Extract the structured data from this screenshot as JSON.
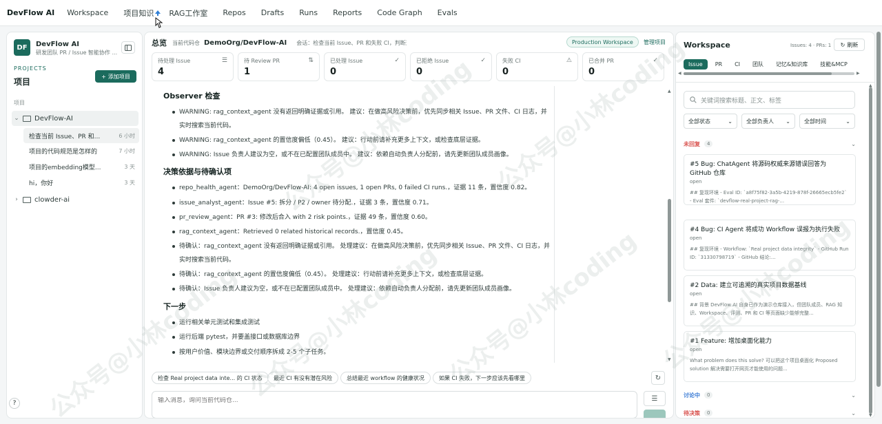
{
  "topnav": {
    "brand": "DevFlow AI",
    "items": [
      "Workspace",
      "项目知识",
      "RAG工作室",
      "Repos",
      "Drafts",
      "Runs",
      "Reports",
      "Code Graph",
      "Evals"
    ]
  },
  "sidebar": {
    "logo": "DF",
    "app_name": "DevFlow AI",
    "app_sub": "研发团队 PR / Issue 智能协作 ...",
    "projects_caption": "PROJECTS",
    "projects_title": "项目",
    "add_project": "添加项目",
    "section_label": "项目",
    "tree": [
      {
        "name": "DevFlow-AI",
        "expanded": true
      },
      {
        "name": "clowder-ai",
        "expanded": false
      }
    ],
    "conversations": [
      {
        "title": "检查当前 Issue、PR 和...",
        "time": "6 小时"
      },
      {
        "title": "项目的代码规范是怎样的",
        "time": "7 小时"
      },
      {
        "title": "项目的embedding模型...",
        "time": "3 天"
      },
      {
        "title": "hi，你好",
        "time": "3 天"
      }
    ],
    "help_icon": "?"
  },
  "center": {
    "title": "总览",
    "current_repo_label": "当前代码仓",
    "repo": "DemoOrg/DevFlow-AI",
    "session": "会话：检查当前 Issue、PR 和失败 CI，判断这...",
    "workspace_badge": "Production Workspace",
    "manage": "管理项目",
    "stats": [
      {
        "label": "待处理 Issue",
        "value": "4",
        "icon": "filter-icon"
      },
      {
        "label": "待 Review PR",
        "value": "1",
        "icon": "pr-icon"
      },
      {
        "label": "已处理 Issue",
        "value": "0",
        "icon": "check-icon"
      },
      {
        "label": "已拒绝 Issue",
        "value": "0",
        "icon": "check-icon"
      },
      {
        "label": "失败 CI",
        "value": "0",
        "icon": "warning-icon"
      },
      {
        "label": "已合并 PR",
        "value": "0",
        "icon": "check-icon"
      }
    ],
    "sections": [
      {
        "heading": "Observer 检查",
        "bullets": [
          "WARNING: rag_context_agent 没有返回明确证据或引用。 建议：在做高风险决策前，优先同步相关 Issue、PR 文件、CI 日志，并实时搜索当前代码。",
          "WARNING: rag_context_agent 的置信度偏低（0.45）。 建议：行动前请补充更多上下文，或检查底层证据。",
          "WARNING: Issue 负责人建议为空，或不在已配置团队成员中。 建议：依赖自动负责人分配前，请先更新团队成员画像。"
        ]
      },
      {
        "heading": "决策依据与待确认项",
        "bullets": [
          "repo_health_agent：DemoOrg/DevFlow-AI: 4 open issues, 1 open PRs, 0 failed CI runs.，证据 11 条，置信度 0.82。",
          "issue_analyst_agent：Issue #5: 拆分 / P2 / owner 待分配.，证据 3 条，置信度 0.71。",
          "pr_review_agent：PR #3: 修改后合入 with 2 risk points.，证据 49 条，置信度 0.60。",
          "rag_context_agent：Retrieved 0 related historical records.，置信度 0.45。",
          "待确认：rag_context_agent 没有返回明确证据或引用。 处理建议：在做高风险决策前，优先同步相关 Issue、PR 文件、CI 日志，并实时搜索当前代码。",
          "待确认：rag_context_agent 的置信度偏低（0.45）。 处理建议：行动前请补充更多上下文，或检查底层证据。",
          "待确认：Issue 负责人建议为空，或不在已配置团队成员中。 处理建议：依赖自动负责人分配前，请先更新团队成员画像。"
        ]
      },
      {
        "heading": "下一步",
        "bullets": [
          "运行相关单元测试和集成测试",
          "运行后端 pytest，并要盖接口或数据库边界",
          "按用户价值、模块边界或交付顺序拆成 2-5 个子任务。"
        ]
      }
    ],
    "chips": [
      "检查 Real project data inte... 的 CI 状态",
      "最近 CI 有没有潜在风险",
      "总结最近 workflow 的健康状况",
      "如果 CI 失败，下一步应该先看哪里"
    ],
    "input_placeholder": "输入消息，询问当前代码仓..."
  },
  "right": {
    "title": "Workspace",
    "counts": "Issues: 4 · PRs: 1",
    "refresh": "刷新",
    "tabs": [
      "Issue",
      "PR",
      "CI",
      "团队",
      "记忆&知识库",
      "技能&MCP"
    ],
    "search_placeholder": "关键词搜索标题、正文、标签",
    "filters": [
      "全部状态",
      "全部负责人",
      "全部时间"
    ],
    "groups": [
      {
        "name": "未回复",
        "count": "4",
        "color": "#d9534f"
      },
      {
        "name": "讨论中",
        "count": "0",
        "color": "#3a7bd5"
      },
      {
        "name": "待决策",
        "count": "0",
        "color": "#d9534f"
      }
    ],
    "cards": [
      {
        "title": "#5 Bug: ChatAgent 将源码权威来源错误回答为 GitHub 仓库",
        "status": "open",
        "desc": "## 复现环境 - Eval ID: `a8f75f82-3a5b-4219-878f-26665ecb5fe2` - Eval 套件: `devflow-real-project-rag-..."
      },
      {
        "title": "#4 Bug: CI Agent 将成功 Workflow 误报为执行失败",
        "status": "open",
        "desc": "## 复现环境 - Workflow: `Real project data integrity` - GitHub Run ID: `31330798719` - GitHub 结论:..."
      },
      {
        "title": "#2 Data: 建立可追溯的真实项目数据基线",
        "status": "open",
        "desc": "## 背景 DevFlow AI 自身已作为演示仓库接入，但团队成员、RAG 知识、Workspace、评测、PR 和 CI 等页面缺少能够完整..."
      },
      {
        "title": "#1 Feature: 增加桌面化能力",
        "status": "open",
        "desc": "What problem does this solve? 可以把这个项目桌面化 Proposed solution 解决需要打开网页才能使用的问题..."
      }
    ]
  },
  "watermark": "公众号@小林coding",
  "colors": {
    "accent": "#1b6b5d",
    "danger": "#d9534f",
    "info": "#3a7bd5"
  }
}
